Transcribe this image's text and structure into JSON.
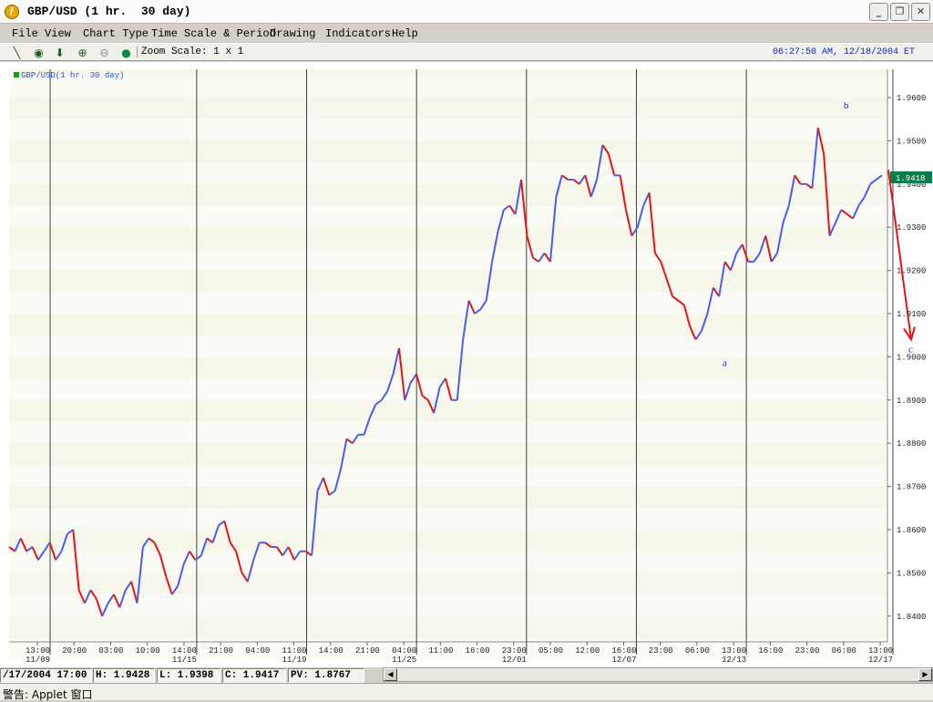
{
  "window": {
    "title": "GBP/USD (1 hr.  30 day)",
    "app_icon": "fxcm-logo-icon",
    "controls": {
      "minimize": "_",
      "maximize": "❐",
      "close": "✕"
    }
  },
  "menu": {
    "items": [
      "File",
      "View",
      "Chart Type",
      "Time Scale & Period",
      "Drawing",
      "Indicators",
      "Help"
    ]
  },
  "toolbar": {
    "tools": [
      "trendline-tool-icon",
      "crosshair-tool-icon",
      "arrow-down-tool-icon",
      "zoom-in-icon",
      "zoom-out-icon",
      "color-dot-icon"
    ],
    "zoom_label": "Zoom Scale: 1 x 1",
    "clock": "06:27:50 AM, 12/18/2004 ET"
  },
  "chart": {
    "legend": "GBP/USD(1 hr.  30 day)",
    "legend_color": "#10a010",
    "current_price_label": "1.9418",
    "current_price_color": "#0b7c4c",
    "wave_labels": [
      "a",
      "b",
      "c"
    ],
    "up_color": "#4a5cf0",
    "down_color": "#e81414",
    "annotation_color": "#e81414",
    "wave_label_color": "#1a2ab0"
  },
  "chart_data": {
    "type": "line",
    "title": "GBP/USD(1 hr.  30 day)",
    "xlabel": "",
    "ylabel": "",
    "ylim": [
      1.835,
      1.966
    ],
    "y_ticks": [
      "1.9600",
      "1.9500",
      "1.9400",
      "1.9300",
      "1.9200",
      "1.9100",
      "1.9000",
      "1.8900",
      "1.8800",
      "1.8700",
      "1.8600",
      "1.8500",
      "1.8400"
    ],
    "x_ticks": [
      {
        "time": "13:00",
        "date": "11/09"
      },
      {
        "time": "20:00",
        "date": ""
      },
      {
        "time": "03:00",
        "date": ""
      },
      {
        "time": "10:00",
        "date": ""
      },
      {
        "time": "14:00",
        "date": "11/15"
      },
      {
        "time": "21:00",
        "date": ""
      },
      {
        "time": "04:00",
        "date": ""
      },
      {
        "time": "11:00",
        "date": "11/19"
      },
      {
        "time": "14:00",
        "date": ""
      },
      {
        "time": "21:00",
        "date": ""
      },
      {
        "time": "04:00",
        "date": "11/25"
      },
      {
        "time": "11:00",
        "date": ""
      },
      {
        "time": "16:00",
        "date": ""
      },
      {
        "time": "23:00",
        "date": "12/01"
      },
      {
        "time": "05:00",
        "date": ""
      },
      {
        "time": "12:00",
        "date": ""
      },
      {
        "time": "16:00",
        "date": "12/07"
      },
      {
        "time": "23:00",
        "date": ""
      },
      {
        "time": "06:00",
        "date": ""
      },
      {
        "time": "13:00",
        "date": "12/13"
      },
      {
        "time": "16:00",
        "date": ""
      },
      {
        "time": "23:00",
        "date": ""
      },
      {
        "time": "06:00",
        "date": ""
      },
      {
        "time": "13:00",
        "date": "12/17"
      }
    ],
    "series": [
      {
        "values": [
          1.856,
          1.855,
          1.858,
          1.855,
          1.856,
          1.853,
          1.855,
          1.857,
          1.853,
          1.855,
          1.859,
          1.86,
          1.846,
          1.843,
          1.846,
          1.844,
          1.84,
          1.843,
          1.845,
          1.842,
          1.846,
          1.848,
          1.843,
          1.856,
          1.858,
          1.857,
          1.854,
          1.849,
          1.845,
          1.847,
          1.852,
          1.855,
          1.853,
          1.854,
          1.858,
          1.857,
          1.861,
          1.862,
          1.857,
          1.855,
          1.85,
          1.848,
          1.853,
          1.857,
          1.857,
          1.856,
          1.856,
          1.854,
          1.856,
          1.853,
          1.855,
          1.855,
          1.854,
          1.869,
          1.872,
          1.868,
          1.869,
          1.874,
          1.881,
          1.88,
          1.882,
          1.882,
          1.886,
          1.889,
          1.89,
          1.892,
          1.896,
          1.902,
          1.89,
          1.894,
          1.896,
          1.891,
          1.89,
          1.887,
          1.893,
          1.895,
          1.89,
          1.89,
          1.904,
          1.913,
          1.91,
          1.911,
          1.913,
          1.922,
          1.929,
          1.934,
          1.935,
          1.933,
          1.941,
          1.928,
          1.923,
          1.922,
          1.924,
          1.922,
          1.937,
          1.942,
          1.941,
          1.941,
          1.94,
          1.942,
          1.937,
          1.941,
          1.949,
          1.947,
          1.942,
          1.942,
          1.934,
          1.928,
          1.93,
          1.935,
          1.938,
          1.924,
          1.922,
          1.918,
          1.914,
          1.913,
          1.912,
          1.907,
          1.904,
          1.906,
          1.91,
          1.916,
          1.914,
          1.922,
          1.92,
          1.924,
          1.926,
          1.922,
          1.922,
          1.924,
          1.928,
          1.922,
          1.924,
          1.931,
          1.935,
          1.942,
          1.94,
          1.94,
          1.939,
          1.953,
          1.947,
          1.928,
          1.931,
          1.934,
          1.933,
          1.932,
          1.935,
          1.937,
          1.94,
          1.941,
          1.942
        ]
      }
    ],
    "annotations": [
      {
        "label": "a",
        "at": "12/13",
        "price": 1.901
      },
      {
        "label": "b",
        "at": "12/17",
        "price": 1.956
      },
      {
        "label": "c",
        "price": 1.904
      }
    ],
    "grid": true,
    "last_price": 1.9418
  },
  "status": {
    "datetime": "/17/2004 17:00",
    "high": "H: 1.9428",
    "low": "L: 1.9398",
    "close": "C: 1.9417",
    "pv": "PV: 1.8767"
  },
  "applet": {
    "text": "警告: Applet 窗口"
  }
}
